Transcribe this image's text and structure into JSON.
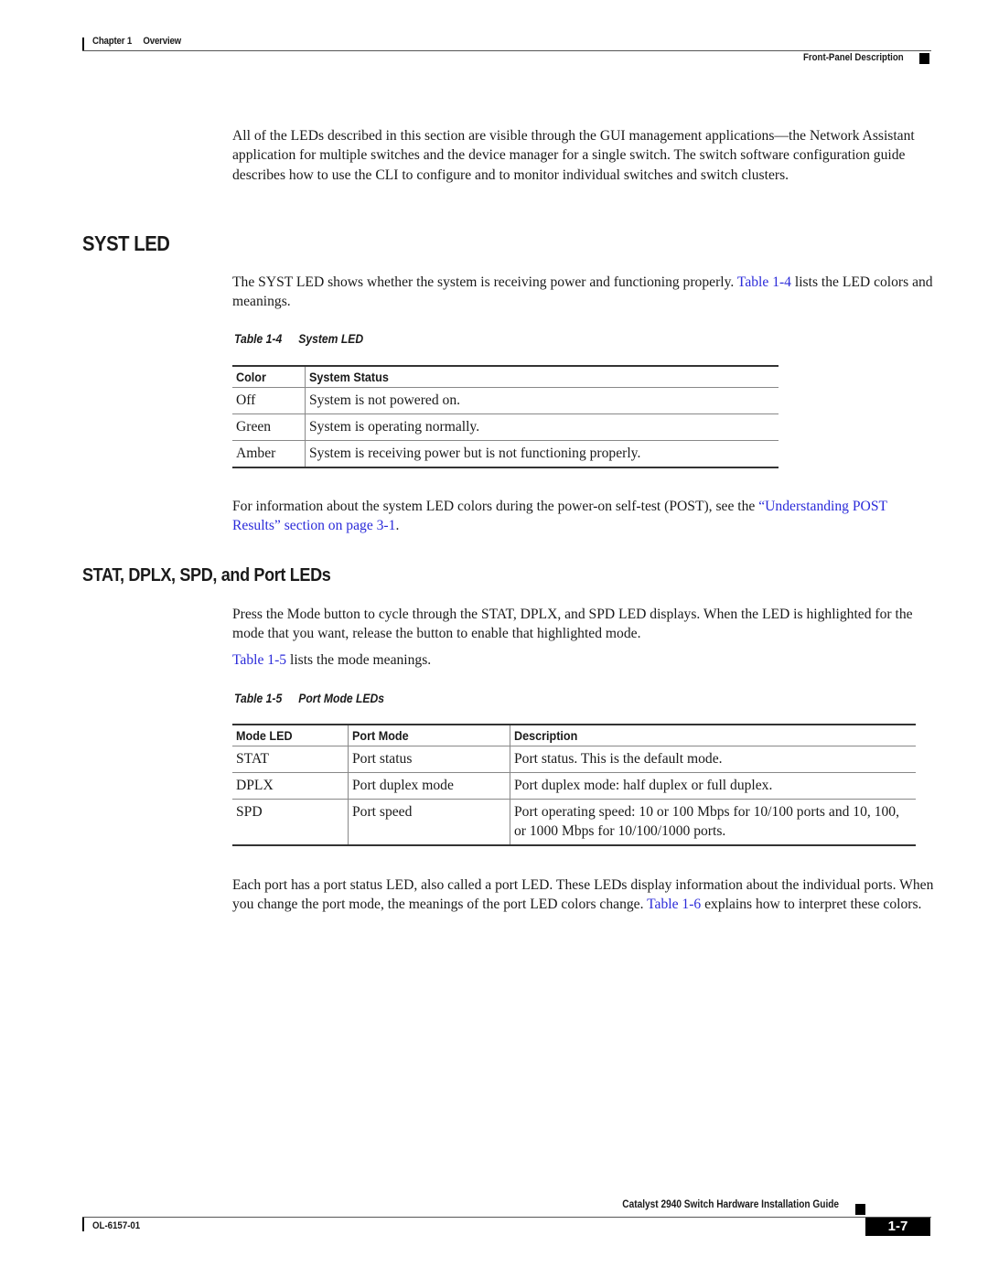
{
  "header": {
    "chapter_label": "Chapter 1",
    "chapter_title": "Overview",
    "section_title": "Front-Panel Description"
  },
  "intro": {
    "text": "All of the LEDs described in this section are visible through the GUI management applications—the Network Assistant application for multiple switches and the device manager for a single switch. The switch software configuration guide describes how to use the CLI to configure and to monitor individual switches and switch clusters."
  },
  "syst_led": {
    "heading": "SYST LED",
    "para_before": "The SYST LED shows whether the system is receiving power and functioning properly. ",
    "para_link": "Table 1-4",
    "para_after": " lists the LED colors and meanings.",
    "table_caption_num": "Table 1-4",
    "table_caption_title": "System LED",
    "table": {
      "headers": [
        "Color",
        "System Status"
      ],
      "rows": [
        [
          "Off",
          "System is not powered on."
        ],
        [
          "Green",
          "System is operating normally."
        ],
        [
          "Amber",
          "System is receiving power but is not functioning properly."
        ]
      ]
    },
    "post_text": "For information about the system LED colors during the power-on self-test (POST), see the ",
    "post_link": "“Understanding POST Results” section on page 3-1",
    "post_end": "."
  },
  "port_leds": {
    "heading": "STAT, DPLX, SPD, and Port LEDs",
    "para1": "Press the Mode button to cycle through the STAT, DPLX, and SPD LED displays. When the LED is highlighted for the mode that you want, release the button to enable that highlighted mode.",
    "para2_link": "Table 1-5",
    "para2_after": " lists the mode meanings.",
    "table_caption_num": "Table 1-5",
    "table_caption_title": "Port Mode LEDs",
    "table": {
      "headers": [
        "Mode LED",
        "Port Mode",
        "Description"
      ],
      "rows": [
        [
          "STAT",
          "Port status",
          "Port status. This is the default mode."
        ],
        [
          "DPLX",
          "Port duplex mode",
          "Port duplex mode: half duplex or full duplex."
        ],
        [
          "SPD",
          "Port speed",
          "Port operating speed: 10 or 100 Mbps for 10/100 ports and 10, 100, or 1000 Mbps for 10/100/1000 ports."
        ]
      ]
    },
    "para3": "Each port has a port status LED, also called a port LED. These LEDs display information about the individual ports. When you change the port mode, the meanings of the port LED colors change. ",
    "para3_link": "Table 1-6",
    "para3_after": " explains how to interpret these colors."
  },
  "footer": {
    "guide_title": "Catalyst 2940 Switch Hardware Installation Guide",
    "doc_number": "OL-6157-01",
    "page_number": "1-7"
  }
}
